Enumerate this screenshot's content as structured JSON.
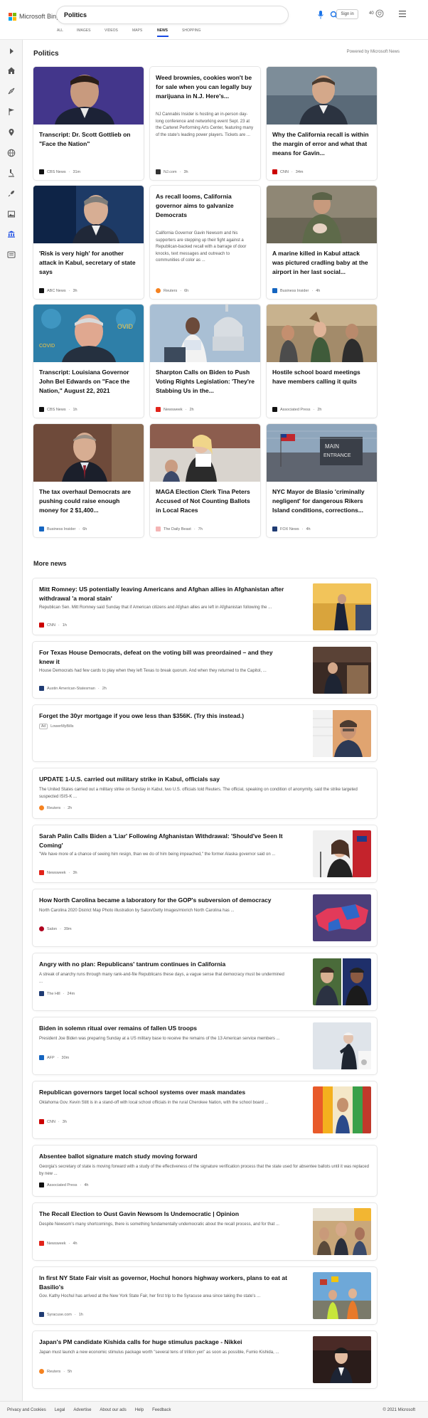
{
  "header": {
    "logo_text": "Microsoft Bing",
    "search_value": "Politics",
    "signin_label": "Sign in",
    "rewards_count": "40",
    "tabs": [
      {
        "label": "ALL"
      },
      {
        "label": "IMAGES"
      },
      {
        "label": "VIDEOS"
      },
      {
        "label": "MAPS"
      },
      {
        "label": "NEWS"
      },
      {
        "label": "SHOPPING"
      }
    ]
  },
  "sidebar": {
    "icons": [
      "expand-arrow-icon",
      "home-icon",
      "compass-icon",
      "flag-icon",
      "map-pin-icon",
      "globe-icon",
      "microscope-icon",
      "rocket-icon",
      "image-icon",
      "bank-icon",
      "newspaper-icon"
    ]
  },
  "main": {
    "section_title": "Politics",
    "powered_by": "Powered by Microsoft News",
    "cards": [
      {
        "title": "Transcript: Dr. Scott Gottlieb on \"Face the Nation\"",
        "snippet": "",
        "source": "CBS News",
        "time": "31m"
      },
      {
        "title": "Weed brownies, cookies won't be for sale when you can legally buy marijuana in N.J. Here's...",
        "snippet": "NJ Cannabis Insider is hosting an in-person day-long conference and networking event Sept. 23 at the Carteret Performing Arts Center, featuring many of the state's leading power players. Tickets are ...",
        "source": "NJ.com",
        "time": "3h"
      },
      {
        "title": "Why the California recall is within the margin of error and what that means for Gavin...",
        "snippet": "",
        "source": "CNN",
        "time": "34m"
      },
      {
        "title": "'Risk is very high' for another attack in Kabul, secretary of state says",
        "snippet": "",
        "source": "ABC News",
        "time": "3h"
      },
      {
        "title": "As recall looms, California governor aims to galvanize Democrats",
        "snippet": "California Governor Gavin Newsom and his supporters are stepping up their fight against a Republican-backed recall with a barrage of door knocks, text messages and outreach to communities of color as ...",
        "source": "Reuters",
        "time": "6h"
      },
      {
        "title": "A marine killed in Kabul attack was pictured cradling baby at the airport in her last social...",
        "snippet": "",
        "source": "Business Insider",
        "time": "4h"
      },
      {
        "title": "Transcript: Louisiana Governor John Bel Edwards on \"Face the Nation,\" August 22, 2021",
        "snippet": "",
        "source": "CBS News",
        "time": "1h"
      },
      {
        "title": "Sharpton Calls on Biden to Push Voting Rights Legislation: 'They're Stabbing Us in the...",
        "snippet": "",
        "source": "Newsweek",
        "time": "2h"
      },
      {
        "title": "Hostile school board meetings have members calling it quits",
        "snippet": "",
        "source": "Associated Press",
        "time": "2h"
      },
      {
        "title": "The tax overhaul Democrats are pushing could raise enough money for 2 $1,400...",
        "snippet": "",
        "source": "Business Insider",
        "time": "6h"
      },
      {
        "title": "MAGA Election Clerk Tina Peters Accused of Not Counting Ballots in Local Races",
        "snippet": "",
        "source": "The Daily Beast",
        "time": "7h"
      },
      {
        "title": "NYC Mayor de Blasio 'criminally negligent' for dangerous Rikers Island conditions, corrections...",
        "snippet": "",
        "source": "FOX News",
        "time": "4h"
      }
    ],
    "more_news_title": "More news",
    "more_news": [
      {
        "title": "Mitt Romney: US potentially leaving Americans and Afghan allies in Afghanistan after withdrawal 'a moral stain'",
        "snippet": "Republican Sen. Mitt Romney said Sunday that if American citizens and Afghan allies are left in Afghanistan following the ...",
        "source": "CNN",
        "time": "1h"
      },
      {
        "title": "For Texas House Democrats, defeat on the voting bill was preordained – and they knew it",
        "snippet": "House Democrats had few cards to play when they left Texas to break quorum. And when they returned to the Capitol, ...",
        "source": "Austin American-Statesman",
        "time": "2h"
      },
      {
        "title": "Forget the 30yr mortgage if you owe less than $356K. (Try this instead.)",
        "snippet": "",
        "ad_label": "Ad",
        "source": "LowerMyBills",
        "time": ""
      },
      {
        "title": "UPDATE 1-U.S. carried out military strike in Kabul, officials say",
        "snippet": "The United States carried out a military strike on Sunday in Kabul, two U.S. officials told Reuters. The official, speaking on condition of anonymity, said the strike targeted suspected ISIS-K ...",
        "source": "Reuters",
        "time": "2h"
      },
      {
        "title": "Sarah Palin Calls Biden a 'Liar' Following Afghanistan Withdrawal: 'Should've Seen It Coming'",
        "snippet": "\"We have more of a chance of seeing him resign, than we do of him being impeached,\" the former Alaska governor said on ...",
        "source": "Newsweek",
        "time": "3h"
      },
      {
        "title": "How North Carolina became a laboratory for the GOP's subversion of democracy",
        "snippet": "North Carolina 2020 District Map Photo illustration by Salon/Getty Images/mixrich North Carolina has ...",
        "source": "Salon",
        "time": "39m"
      },
      {
        "title": "Angry with no plan: Republicans' tantrum continues in California",
        "snippet": "A streak of anarchy runs through many rank-and-file Republicans these days, a vague sense that democracy must be undermined ...",
        "source": "The Hill",
        "time": "24m"
      },
      {
        "title": "Biden in solemn ritual over remains of fallen US troops",
        "snippet": "President Joe Biden was preparing Sunday at a US military base to receive the remains of the 13 American service members ...",
        "source": "AFP",
        "time": "30m"
      },
      {
        "title": "Republican governors target local school systems over mask mandates",
        "snippet": "Oklahoma Gov. Kevin Stitt is in a stand-off with local school officials in the rural Cherokee Nation, with the school board ...",
        "source": "CNN",
        "time": "3h"
      },
      {
        "title": "Absentee ballot signature match study moving forward",
        "snippet": "Georgia's secretary of state is moving forward with a study of the effectiveness of the signature verification process that the state used for absentee ballots until it was replaced by new ...",
        "source": "Associated Press",
        "time": "4h"
      },
      {
        "title": "The Recall Election to Oust Gavin Newsom Is Undemocratic | Opinion",
        "snippet": "Despite Newsom's many shortcomings, there is something fundamentally undemocratic about the recall process, and for that ...",
        "source": "Newsweek",
        "time": "4h"
      },
      {
        "title": "In first NY State Fair visit as governor, Hochul honors highway workers, plans to eat at Basilio's",
        "snippet": "Gov. Kathy Hochul has arrived at the New York State Fair, her first trip to the Syracuse area since taking the state's ...",
        "source": "Syracuse.com",
        "time": "1h"
      },
      {
        "title": "Japan's PM candidate Kishida calls for huge stimulus package - Nikkei",
        "snippet": "Japan must launch a new economic stimulus package worth \"several tens of trillion yen\" as soon as possible, Fumio Kishida, ...",
        "source": "Reuters",
        "time": "5h"
      }
    ]
  },
  "footer": {
    "links": [
      "Privacy and Cookies",
      "Legal",
      "Advertise",
      "About our ads",
      "Help",
      "Feedback"
    ],
    "copyright": "© 2021 Microsoft"
  }
}
